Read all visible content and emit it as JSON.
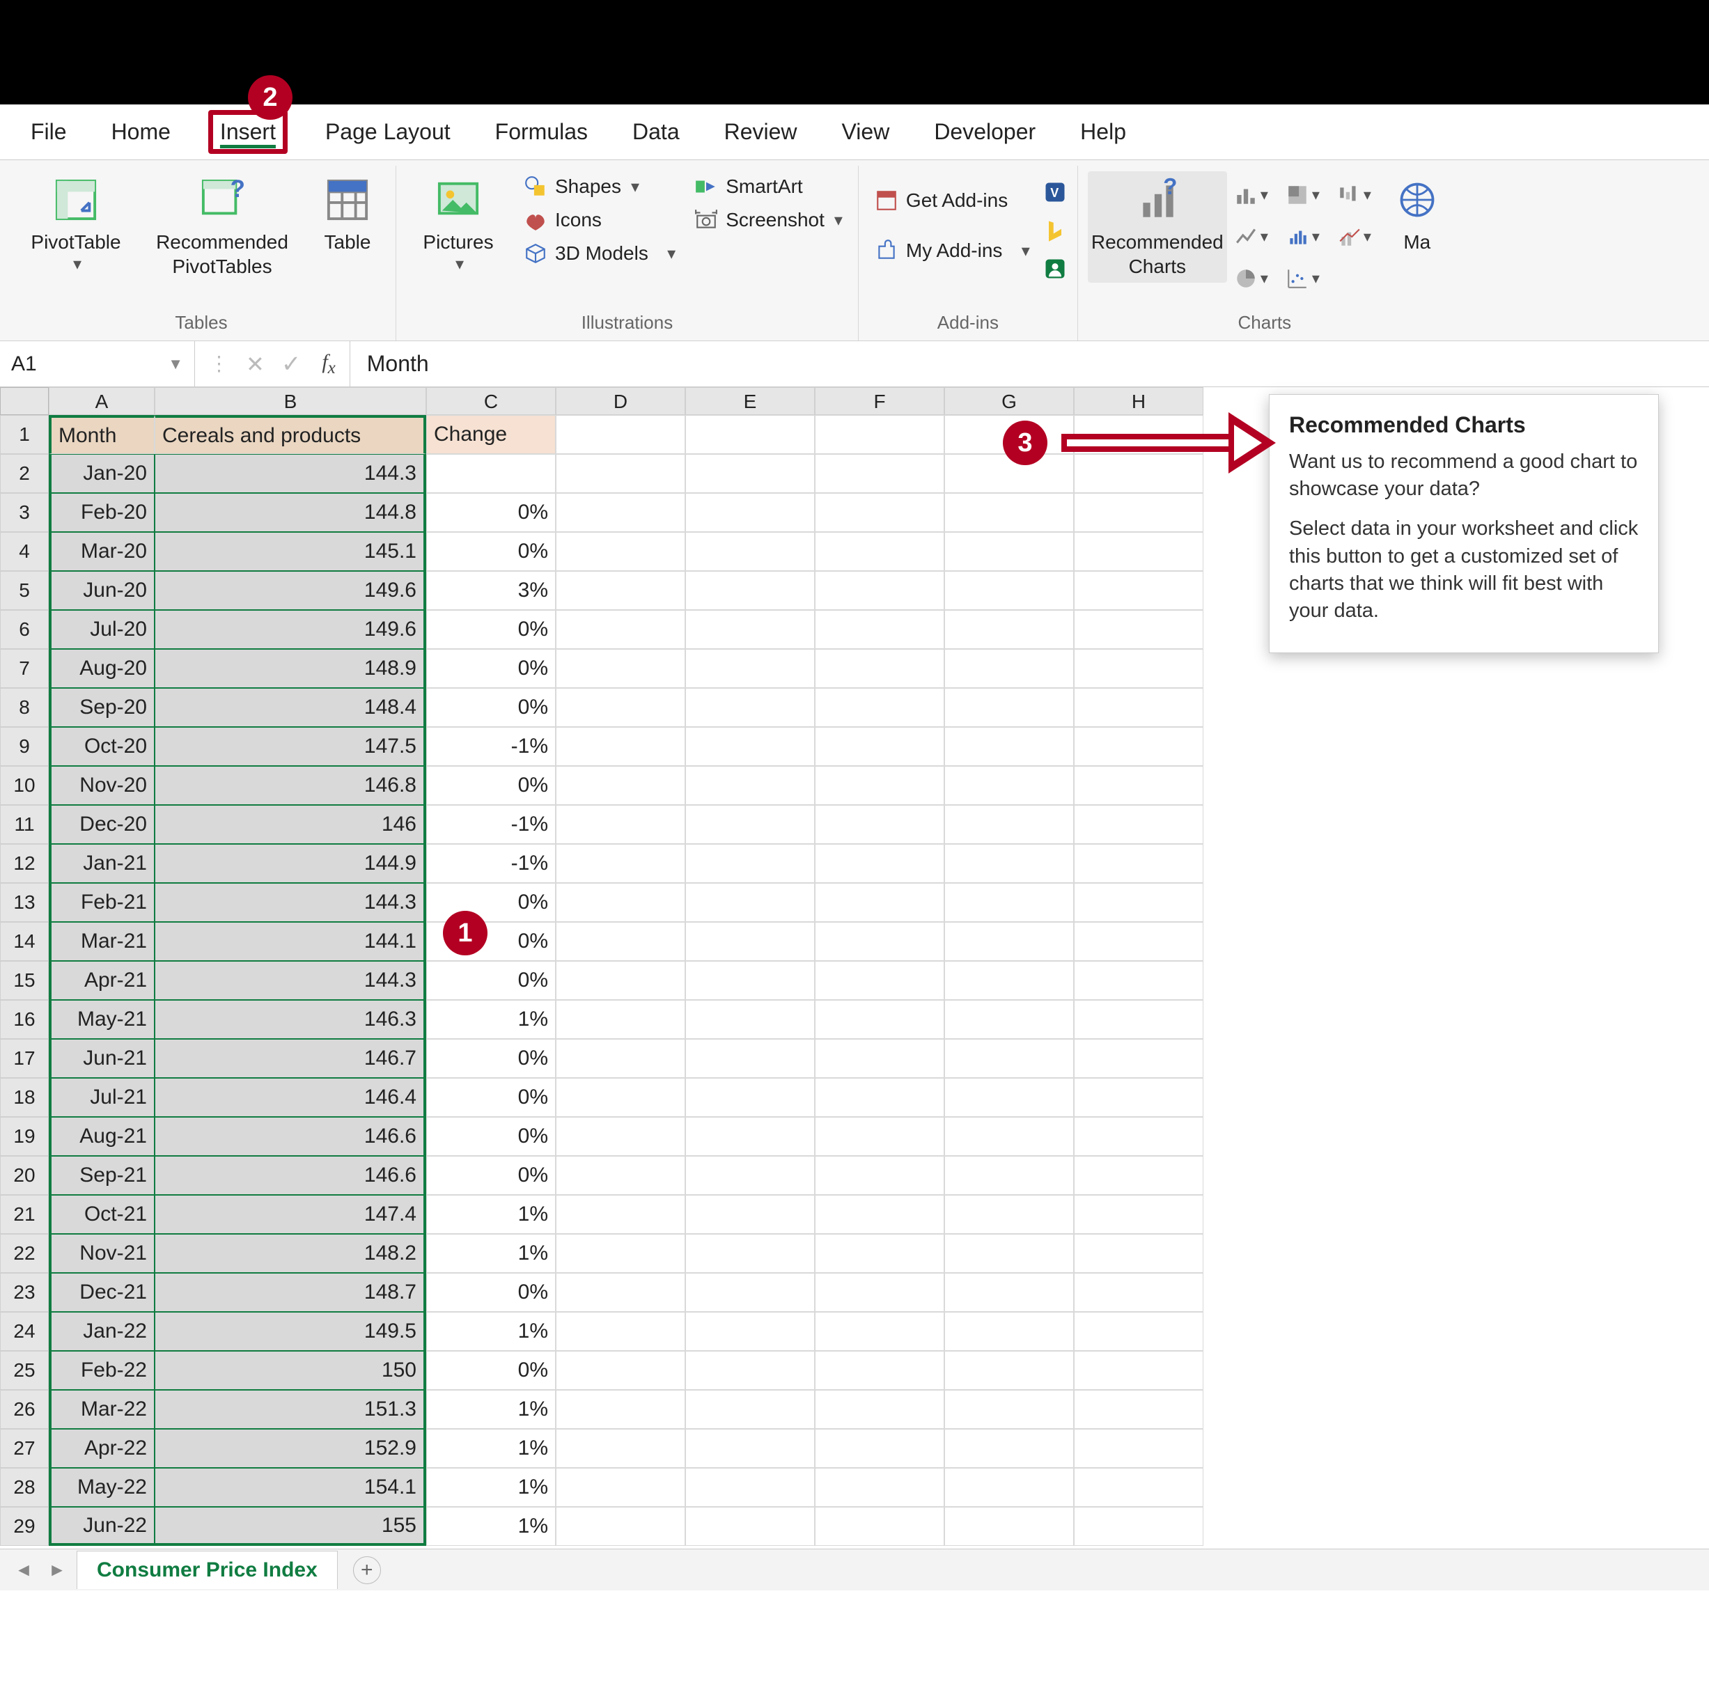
{
  "annotations": {
    "badge1": "1",
    "badge2": "2",
    "badge3": "3"
  },
  "tabs": {
    "file": "File",
    "home": "Home",
    "insert": "Insert",
    "page_layout": "Page Layout",
    "formulas": "Formulas",
    "data": "Data",
    "review": "Review",
    "view": "View",
    "developer": "Developer",
    "help": "Help"
  },
  "ribbon": {
    "tables": {
      "pivot": "PivotTable",
      "rec_pivot": "Recommended PivotTables",
      "table": "Table",
      "group": "Tables"
    },
    "illus": {
      "pictures": "Pictures",
      "shapes": "Shapes",
      "icons": "Icons",
      "models": "3D Models",
      "smartart": "SmartArt",
      "screenshot": "Screenshot",
      "group": "Illustrations"
    },
    "addins": {
      "get": "Get Add-ins",
      "my": "My Add-ins",
      "group": "Add-ins"
    },
    "charts": {
      "rec": "Recommended Charts",
      "group": "Charts",
      "maps_trunc": "Ma"
    }
  },
  "formula_bar": {
    "name": "A1",
    "value": "Month"
  },
  "columns": [
    "A",
    "B",
    "C",
    "D",
    "E",
    "F",
    "G",
    "H"
  ],
  "headers": {
    "a": "Month",
    "b": "Cereals and products",
    "c": "Change"
  },
  "rows": [
    {
      "n": 1
    },
    {
      "n": 2,
      "a": "Jan-20",
      "b": "144.3",
      "c": ""
    },
    {
      "n": 3,
      "a": "Feb-20",
      "b": "144.8",
      "c": "0%"
    },
    {
      "n": 4,
      "a": "Mar-20",
      "b": "145.1",
      "c": "0%"
    },
    {
      "n": 5,
      "a": "Jun-20",
      "b": "149.6",
      "c": "3%"
    },
    {
      "n": 6,
      "a": "Jul-20",
      "b": "149.6",
      "c": "0%"
    },
    {
      "n": 7,
      "a": "Aug-20",
      "b": "148.9",
      "c": "0%"
    },
    {
      "n": 8,
      "a": "Sep-20",
      "b": "148.4",
      "c": "0%"
    },
    {
      "n": 9,
      "a": "Oct-20",
      "b": "147.5",
      "c": "-1%"
    },
    {
      "n": 10,
      "a": "Nov-20",
      "b": "146.8",
      "c": "0%"
    },
    {
      "n": 11,
      "a": "Dec-20",
      "b": "146",
      "c": "-1%"
    },
    {
      "n": 12,
      "a": "Jan-21",
      "b": "144.9",
      "c": "-1%"
    },
    {
      "n": 13,
      "a": "Feb-21",
      "b": "144.3",
      "c": "0%"
    },
    {
      "n": 14,
      "a": "Mar-21",
      "b": "144.1",
      "c": "0%"
    },
    {
      "n": 15,
      "a": "Apr-21",
      "b": "144.3",
      "c": "0%"
    },
    {
      "n": 16,
      "a": "May-21",
      "b": "146.3",
      "c": "1%"
    },
    {
      "n": 17,
      "a": "Jun-21",
      "b": "146.7",
      "c": "0%"
    },
    {
      "n": 18,
      "a": "Jul-21",
      "b": "146.4",
      "c": "0%"
    },
    {
      "n": 19,
      "a": "Aug-21",
      "b": "146.6",
      "c": "0%"
    },
    {
      "n": 20,
      "a": "Sep-21",
      "b": "146.6",
      "c": "0%"
    },
    {
      "n": 21,
      "a": "Oct-21",
      "b": "147.4",
      "c": "1%"
    },
    {
      "n": 22,
      "a": "Nov-21",
      "b": "148.2",
      "c": "1%"
    },
    {
      "n": 23,
      "a": "Dec-21",
      "b": "148.7",
      "c": "0%"
    },
    {
      "n": 24,
      "a": "Jan-22",
      "b": "149.5",
      "c": "1%"
    },
    {
      "n": 25,
      "a": "Feb-22",
      "b": "150",
      "c": "0%"
    },
    {
      "n": 26,
      "a": "Mar-22",
      "b": "151.3",
      "c": "1%"
    },
    {
      "n": 27,
      "a": "Apr-22",
      "b": "152.9",
      "c": "1%"
    },
    {
      "n": 28,
      "a": "May-22",
      "b": "154.1",
      "c": "1%"
    },
    {
      "n": 29,
      "a": "Jun-22",
      "b": "155",
      "c": "1%"
    }
  ],
  "tooltip": {
    "title": "Recommended Charts",
    "p1": "Want us to recommend a good chart to showcase your data?",
    "p2": "Select data in your worksheet and click this button to get a customized set of charts that we think will fit best with your data."
  },
  "sheet_tab": {
    "name": "Consumer Price Index"
  }
}
